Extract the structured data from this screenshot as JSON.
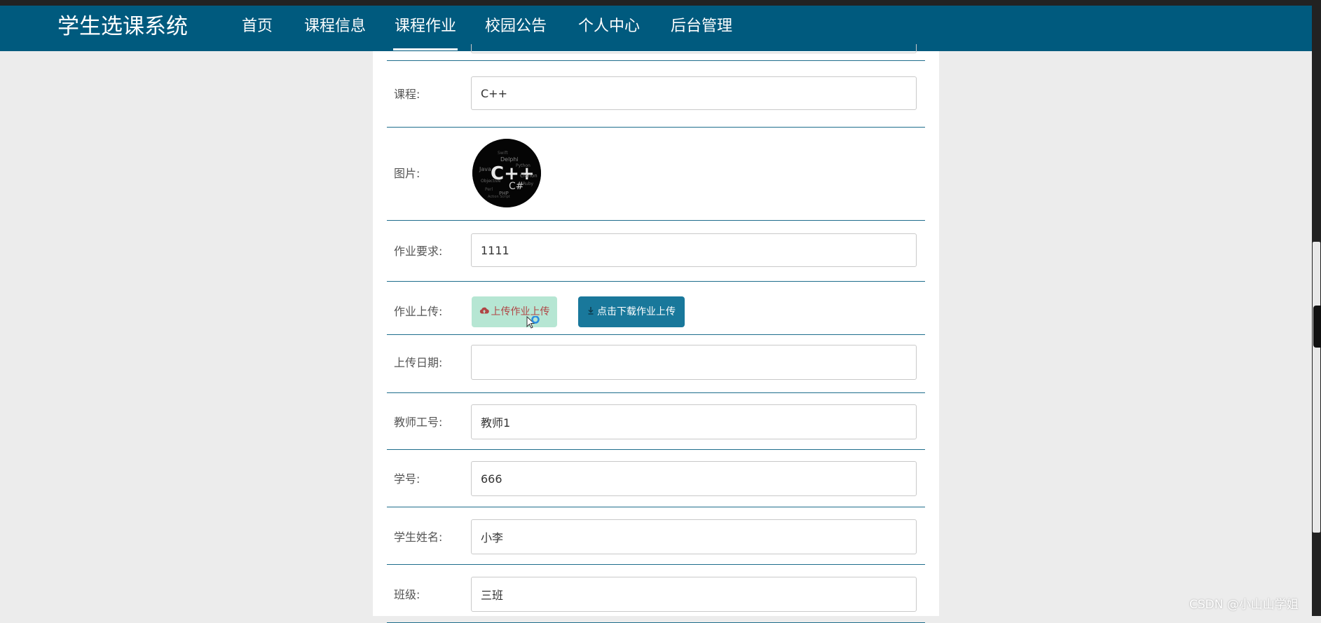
{
  "header": {
    "brand": "学生选课系统",
    "nav": [
      "首页",
      "课程信息",
      "课程作业",
      "校园公告",
      "个人中心",
      "后台管理"
    ],
    "active_index": 2
  },
  "form": {
    "course": {
      "label": "课程:",
      "value": "C++"
    },
    "image": {
      "label": "图片:",
      "logo_text": "C++",
      "logo_text_2": "C#",
      "tag_words": [
        "Java",
        "Delphi",
        "Python",
        "Clarion",
        "Ruby",
        "Objective",
        "PHP",
        "Perl",
        "Swift",
        "Action Script"
      ]
    },
    "requirement": {
      "label": "作业要求:",
      "value": "1111"
    },
    "upload": {
      "label": "作业上传:",
      "upload_button": "上传作业上传",
      "download_button": "点击下载作业上传"
    },
    "upload_date": {
      "label": "上传日期:",
      "value": ""
    },
    "teacher_id": {
      "label": "教师工号:",
      "value": "教师1"
    },
    "student_id": {
      "label": "学号:",
      "value": "666"
    },
    "student_name": {
      "label": "学生姓名:",
      "value": "小李"
    },
    "class_name": {
      "label": "班级:",
      "value": "三班"
    }
  },
  "watermark": "CSDN @小山山学姐",
  "colors": {
    "navbar": "#005a7e",
    "upload_button_bg": "#b6e6d3",
    "download_button_bg": "#19789b",
    "divider": "#1e6d8c"
  }
}
